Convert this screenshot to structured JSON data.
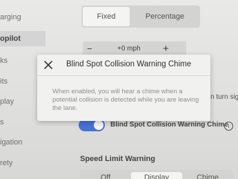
{
  "sidebar": {
    "items": [
      {
        "label": "arging"
      },
      {
        "label": "opilot"
      },
      {
        "label": "ks"
      },
      {
        "label": "its"
      },
      {
        "label": "play"
      },
      {
        "label": "s"
      },
      {
        "label": "igation"
      },
      {
        "label": "rety"
      }
    ]
  },
  "top_segment": {
    "options": [
      "Fixed",
      "Percentage"
    ],
    "selected": "Fixed"
  },
  "offset_stepper": {
    "minus": "−",
    "value": "+0 mph",
    "plus": "+"
  },
  "turn_signal_partial": "n turn sig",
  "blind_spot_setting": {
    "label": "Blind Spot Collision Warning Chime",
    "enabled": true
  },
  "speed_limit": {
    "heading": "Speed Limit Warning",
    "options": [
      "Off",
      "Display",
      "Chime"
    ],
    "selected": "Display"
  },
  "dialog": {
    "title": "Blind Spot Collision Warning Chime",
    "close": "×",
    "body": "When enabled, you will hear a chime when a potential collision is detected while you are leaving the lane."
  },
  "colors": {
    "toggle_on": "#2f5fd0"
  }
}
